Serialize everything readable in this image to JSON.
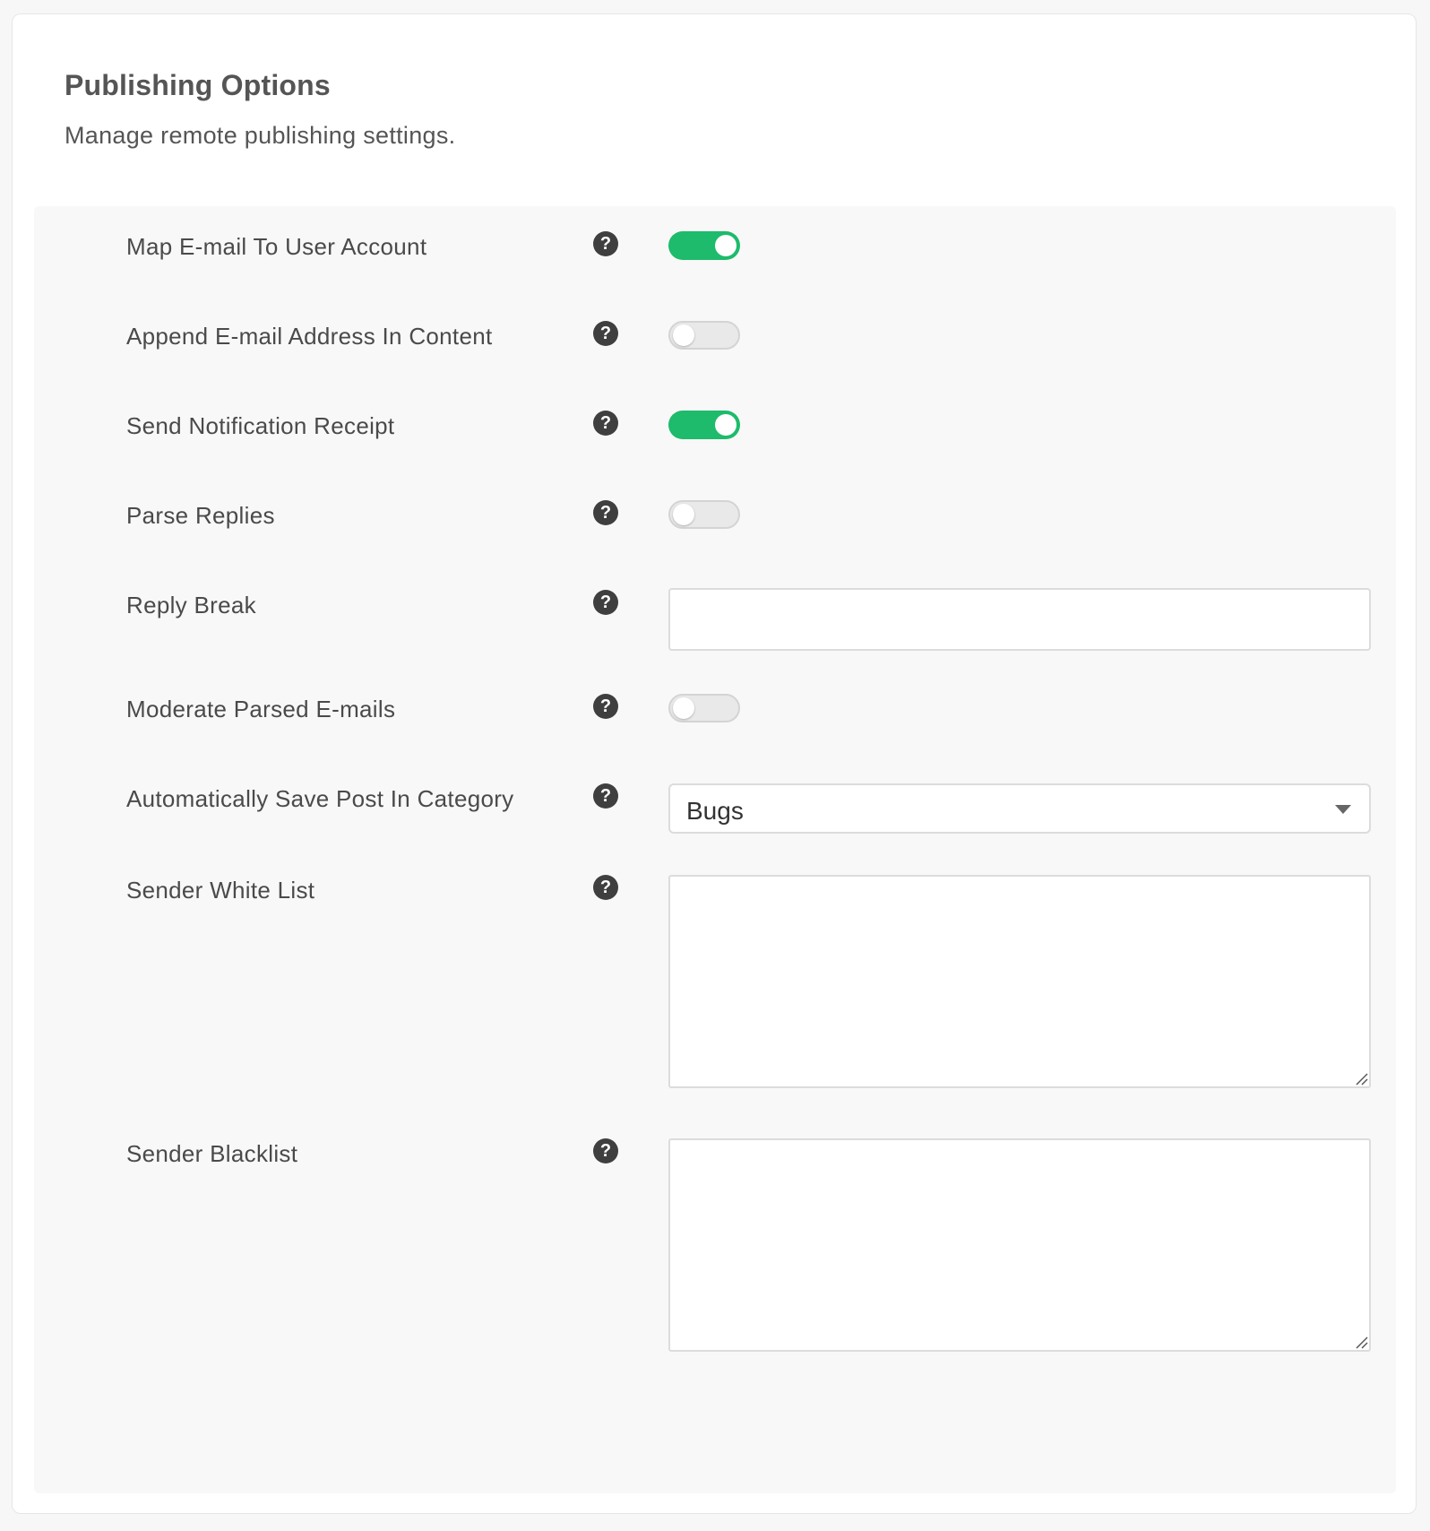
{
  "header": {
    "title": "Publishing Options",
    "description": "Manage remote publishing settings."
  },
  "settings": {
    "map_email": {
      "label": "Map E-mail To User Account",
      "help_glyph": "?",
      "enabled": true
    },
    "append_email": {
      "label": "Append E-mail Address In Content",
      "help_glyph": "?",
      "enabled": false
    },
    "send_receipt": {
      "label": "Send Notification Receipt",
      "help_glyph": "?",
      "enabled": true
    },
    "parse_replies": {
      "label": "Parse Replies",
      "help_glyph": "?",
      "enabled": false
    },
    "reply_break": {
      "label": "Reply Break",
      "help_glyph": "?",
      "value": "",
      "placeholder": ""
    },
    "moderate_parsed": {
      "label": "Moderate Parsed E-mails",
      "help_glyph": "?",
      "enabled": false
    },
    "auto_category": {
      "label": "Automatically Save Post In Category",
      "help_glyph": "?",
      "selected": "Bugs"
    },
    "white_list": {
      "label": "Sender White List",
      "help_glyph": "?",
      "value": ""
    },
    "blacklist": {
      "label": "Sender Blacklist",
      "help_glyph": "?",
      "value": ""
    }
  },
  "colors": {
    "toggle_on": "#1dbb6b",
    "toggle_off": "#e9e9e9",
    "help_icon": "#3f3f3f"
  },
  "icons": {
    "help": "help-circle-icon",
    "dropdown": "chevron-down-icon",
    "resize": "resize-grip-icon"
  }
}
